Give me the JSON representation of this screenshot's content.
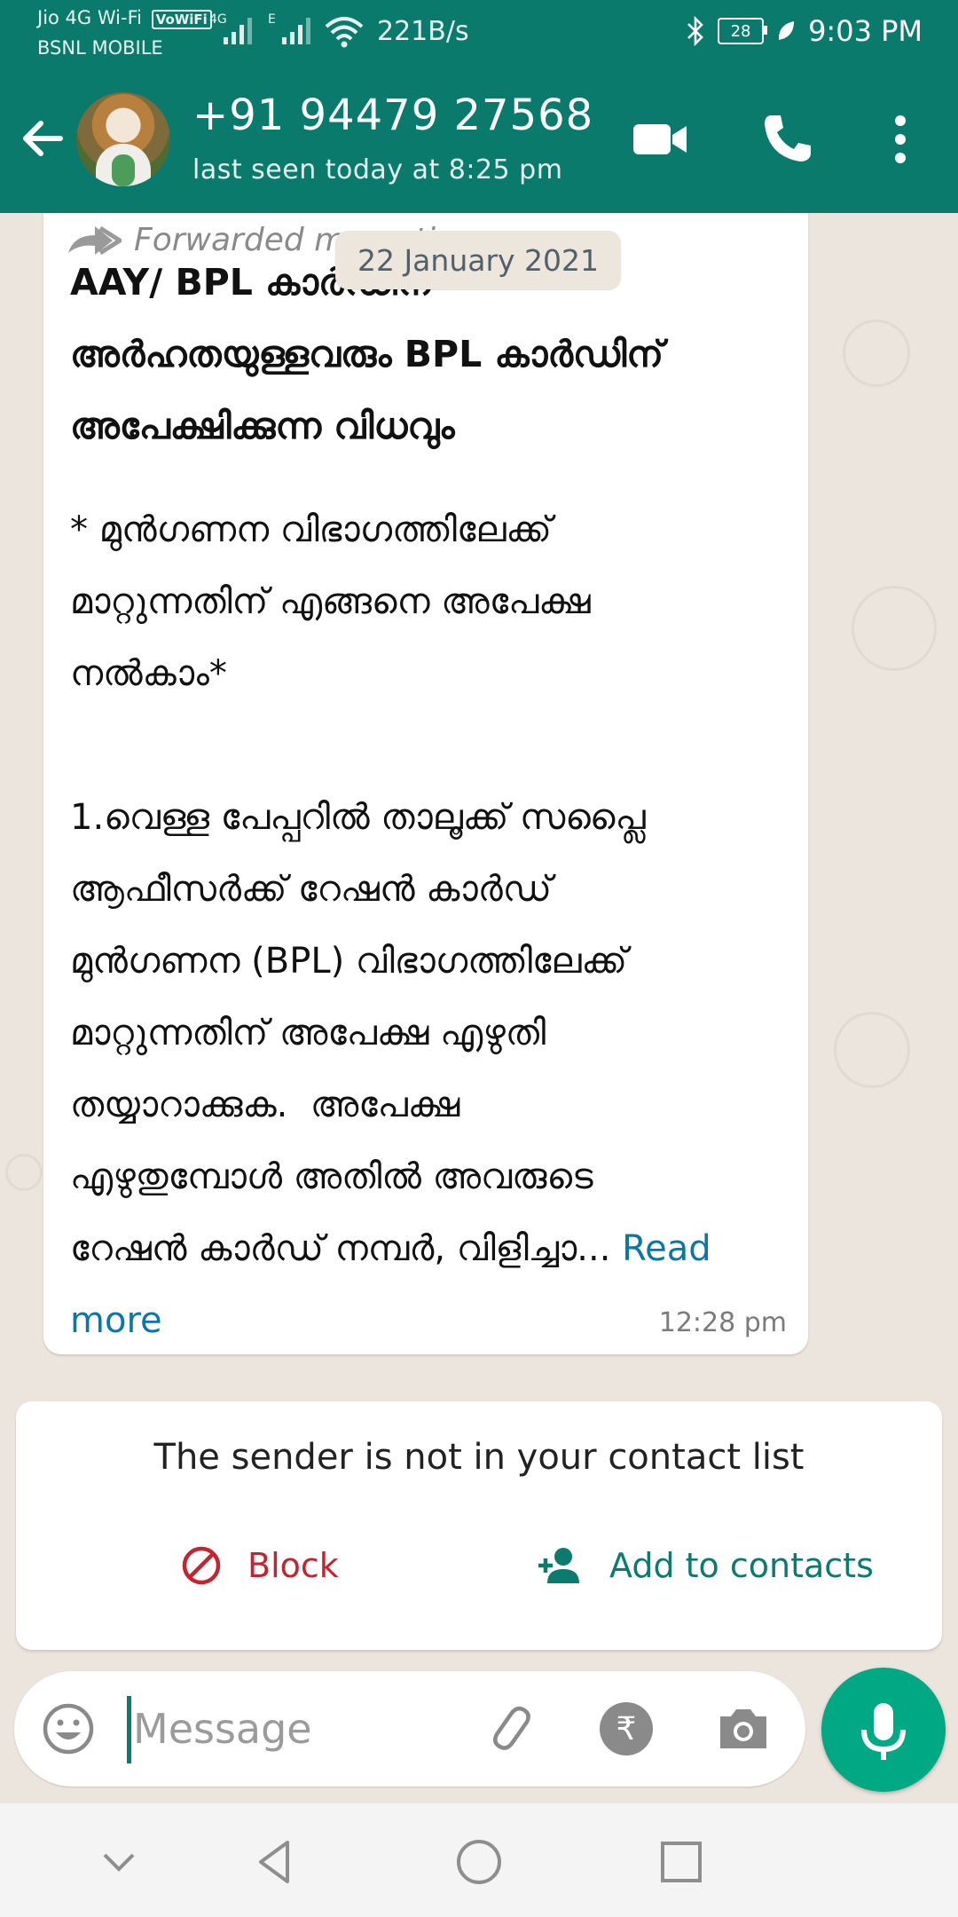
{
  "status_bar": {
    "carrier_top": "Jio 4G Wi-Fi",
    "volte": "VoWiFi",
    "carrier_bottom": "BSNL MOBILE",
    "net_tag_1": "4G",
    "net_tag_2": "E",
    "speed": "221B/s",
    "battery": "28",
    "time": "9:03 PM"
  },
  "header": {
    "contact_name": "+91 94479 27568",
    "last_seen": "last seen today at 8:25 pm"
  },
  "date_chip": "22 January 2021",
  "message": {
    "forwarded_label": "Forwarded many times",
    "title_lines": "AAY/ BPL കാർഡിന്\nഅർഹതയുള്ളവരും BPL കാർഡിന്\nഅപേക്ഷിക്കുന്ന വിധവും",
    "body": "* മുൻഗണന വിഭാഗത്തിലേക്ക്\nമാറ്റുന്നതിന് എങ്ങനെ അപേക്ഷ\nനൽകാം*\n\n1.വെള്ള പേപ്പറിൽ താലൂക്ക് സപ്ലൈ\nആഫീസർക്ക് റേഷൻ കാർഡ്\nമുൻഗണന (BPL) വിഭാഗത്തിലേക്ക്\nമാറ്റുന്നതിന് അപേക്ഷ എഴുതി\nതയ്യാറാക്കുക.  അപേക്ഷ\nഎഴുതുമ്പോൾ അതിൽ അവരുടെ\nറേഷൻ കാർഡ് നമ്പർ, വിളിച്ചാ... ",
    "read_more": "Read\nmore",
    "time": "12:28 pm"
  },
  "unknown_sender": {
    "text": "The sender is not in your contact list",
    "block_label": "Block",
    "add_label": "Add to contacts"
  },
  "composer": {
    "placeholder": "Message"
  },
  "colors": {
    "header": "#0a7a6c",
    "chat_bg": "#ece5dd",
    "mic": "#00a884",
    "link": "#0b77a8",
    "block": "#c3242f"
  }
}
